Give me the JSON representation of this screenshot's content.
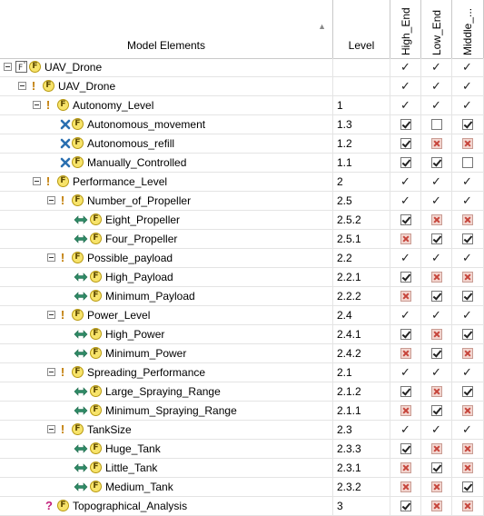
{
  "header": {
    "model_elements": "Model Elements",
    "level": "Level",
    "configs": [
      "High_End",
      "Low_End",
      "Middle_..."
    ]
  },
  "rows": [
    {
      "label": "UAV_Drone",
      "level": "",
      "depth": 0,
      "type": "root",
      "expand": true,
      "cells": [
        "check",
        "check",
        "check"
      ]
    },
    {
      "label": "UAV_Drone",
      "level": "",
      "depth": 1,
      "type": "excl",
      "expand": true,
      "cells": [
        "check",
        "check",
        "check"
      ]
    },
    {
      "label": "Autonomy_Level",
      "level": "1",
      "depth": 2,
      "type": "excl",
      "expand": true,
      "cells": [
        "check",
        "check",
        "check"
      ]
    },
    {
      "label": "Autonomous_movement",
      "level": "1.3",
      "depth": 3,
      "type": "xor",
      "expand": false,
      "cells": [
        "box-check",
        "box-empty",
        "box-check"
      ]
    },
    {
      "label": "Autonomous_refill",
      "level": "1.2",
      "depth": 3,
      "type": "xor",
      "expand": false,
      "cells": [
        "box-check",
        "box-x",
        "box-x"
      ]
    },
    {
      "label": "Manually_Controlled",
      "level": "1.1",
      "depth": 3,
      "type": "xor",
      "expand": false,
      "cells": [
        "box-check",
        "box-check",
        "box-empty"
      ]
    },
    {
      "label": "Performance_Level",
      "level": "2",
      "depth": 2,
      "type": "excl",
      "expand": true,
      "cells": [
        "check",
        "check",
        "check"
      ]
    },
    {
      "label": "Number_of_Propeller",
      "level": "2.5",
      "depth": 3,
      "type": "excl",
      "expand": true,
      "cells": [
        "check",
        "check",
        "check"
      ]
    },
    {
      "label": "Eight_Propeller",
      "level": "2.5.2",
      "depth": 4,
      "type": "alt",
      "expand": false,
      "cells": [
        "box-check",
        "box-x",
        "box-x"
      ]
    },
    {
      "label": "Four_Propeller",
      "level": "2.5.1",
      "depth": 4,
      "type": "alt",
      "expand": false,
      "cells": [
        "box-x",
        "box-check",
        "box-check"
      ]
    },
    {
      "label": "Possible_payload",
      "level": "2.2",
      "depth": 3,
      "type": "excl",
      "expand": true,
      "cells": [
        "check",
        "check",
        "check"
      ]
    },
    {
      "label": "High_Payload",
      "level": "2.2.1",
      "depth": 4,
      "type": "alt",
      "expand": false,
      "cells": [
        "box-check",
        "box-x",
        "box-x"
      ]
    },
    {
      "label": "Minimum_Payload",
      "level": "2.2.2",
      "depth": 4,
      "type": "alt",
      "expand": false,
      "cells": [
        "box-x",
        "box-check",
        "box-check"
      ]
    },
    {
      "label": "Power_Level",
      "level": "2.4",
      "depth": 3,
      "type": "excl",
      "expand": true,
      "cells": [
        "check",
        "check",
        "check"
      ]
    },
    {
      "label": "High_Power",
      "level": "2.4.1",
      "depth": 4,
      "type": "alt",
      "expand": false,
      "cells": [
        "box-check",
        "box-x",
        "box-check"
      ]
    },
    {
      "label": "Minimum_Power",
      "level": "2.4.2",
      "depth": 4,
      "type": "alt",
      "expand": false,
      "cells": [
        "box-x",
        "box-check",
        "box-x"
      ]
    },
    {
      "label": "Spreading_Performance",
      "level": "2.1",
      "depth": 3,
      "type": "excl",
      "expand": true,
      "cells": [
        "check",
        "check",
        "check"
      ]
    },
    {
      "label": "Large_Spraying_Range",
      "level": "2.1.2",
      "depth": 4,
      "type": "alt",
      "expand": false,
      "cells": [
        "box-check",
        "box-x",
        "box-check"
      ]
    },
    {
      "label": "Minimum_Spraying_Range",
      "level": "2.1.1",
      "depth": 4,
      "type": "alt",
      "expand": false,
      "cells": [
        "box-x",
        "box-check",
        "box-x"
      ]
    },
    {
      "label": "TankSize",
      "level": "2.3",
      "depth": 3,
      "type": "excl",
      "expand": true,
      "cells": [
        "check",
        "check",
        "check"
      ]
    },
    {
      "label": "Huge_Tank",
      "level": "2.3.3",
      "depth": 4,
      "type": "alt",
      "expand": false,
      "cells": [
        "box-check",
        "box-x",
        "box-x"
      ]
    },
    {
      "label": "Little_Tank",
      "level": "2.3.1",
      "depth": 4,
      "type": "alt",
      "expand": false,
      "cells": [
        "box-x",
        "box-check",
        "box-x"
      ]
    },
    {
      "label": "Medium_Tank",
      "level": "2.3.2",
      "depth": 4,
      "type": "alt",
      "expand": false,
      "cells": [
        "box-x",
        "box-x",
        "box-check"
      ]
    },
    {
      "label": "Topographical_Analysis",
      "level": "3",
      "depth": 2,
      "type": "question",
      "expand": false,
      "cells": [
        "box-check",
        "box-x",
        "box-x"
      ]
    }
  ]
}
